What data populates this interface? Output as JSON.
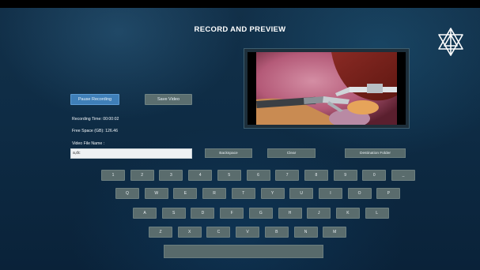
{
  "header": {
    "title": "RECORD AND PREVIEW"
  },
  "logo": {
    "icon": "tri-star-logo-icon"
  },
  "controls": {
    "pause_label": "Pause Recording",
    "save_label": "Save Video"
  },
  "status": {
    "recording_time": "Recording Time: 00:00:02",
    "free_space": "Free Space (GB): 126.46",
    "file_name_label": "Video File Name :",
    "file_name_value": "a,dc"
  },
  "preview": {
    "icon": "video-preview-icon"
  },
  "edit_buttons": {
    "backspace": "Backspace",
    "clear": "Clear",
    "destination": "Destination Folder"
  },
  "keyboard": {
    "row1": [
      "1",
      "2",
      "3",
      "4",
      "5",
      "6",
      "7",
      "8",
      "9",
      "0",
      "_"
    ],
    "row2": [
      "Q",
      "W",
      "E",
      "R",
      "T",
      "Y",
      "U",
      "I",
      "O",
      "P"
    ],
    "row3": [
      "A",
      "S",
      "D",
      "F",
      "G",
      "H",
      "J",
      "K",
      "L"
    ],
    "row4": [
      "Z",
      "X",
      "C",
      "V",
      "B",
      "N",
      "M"
    ]
  },
  "colors": {
    "accent": "#3f7fb8",
    "key": "#5a6c6d",
    "background": "#0e2c45"
  }
}
